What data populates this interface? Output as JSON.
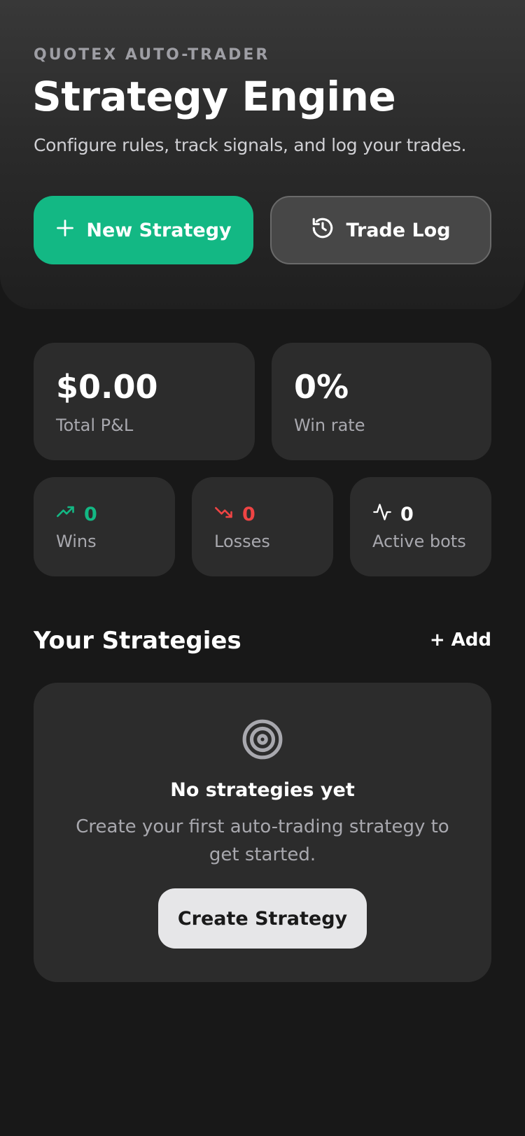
{
  "header": {
    "eyebrow": "QUOTEX AUTO-TRADER",
    "title": "Strategy Engine",
    "subtitle": "Configure rules, track signals, and log your trades."
  },
  "actions": {
    "new_strategy_label": "New Strategy",
    "new_strategy_icon": "plus-icon",
    "trade_log_label": "Trade Log",
    "trade_log_icon": "history-icon"
  },
  "stats": {
    "total_pnl": {
      "value": "$0.00",
      "label": "Total P&L"
    },
    "win_rate": {
      "value": "0%",
      "label": "Win rate"
    },
    "wins": {
      "value": "0",
      "label": "Wins",
      "icon": "trending-up-icon",
      "color": "#13b884"
    },
    "losses": {
      "value": "0",
      "label": "Losses",
      "icon": "trending-down-icon",
      "color": "#ef4444"
    },
    "active_bots": {
      "value": "0",
      "label": "Active bots",
      "icon": "activity-icon",
      "color": "#ffffff"
    }
  },
  "strategies": {
    "section_title": "Your Strategies",
    "add_label": "+ Add",
    "empty": {
      "icon": "target-icon",
      "title": "No strategies yet",
      "description": "Create your first auto-trading strategy to get started.",
      "cta_label": "Create Strategy"
    }
  },
  "colors": {
    "accent": "#13b884",
    "loss": "#ef4444",
    "background": "#181818",
    "card": "#2c2c2c"
  }
}
